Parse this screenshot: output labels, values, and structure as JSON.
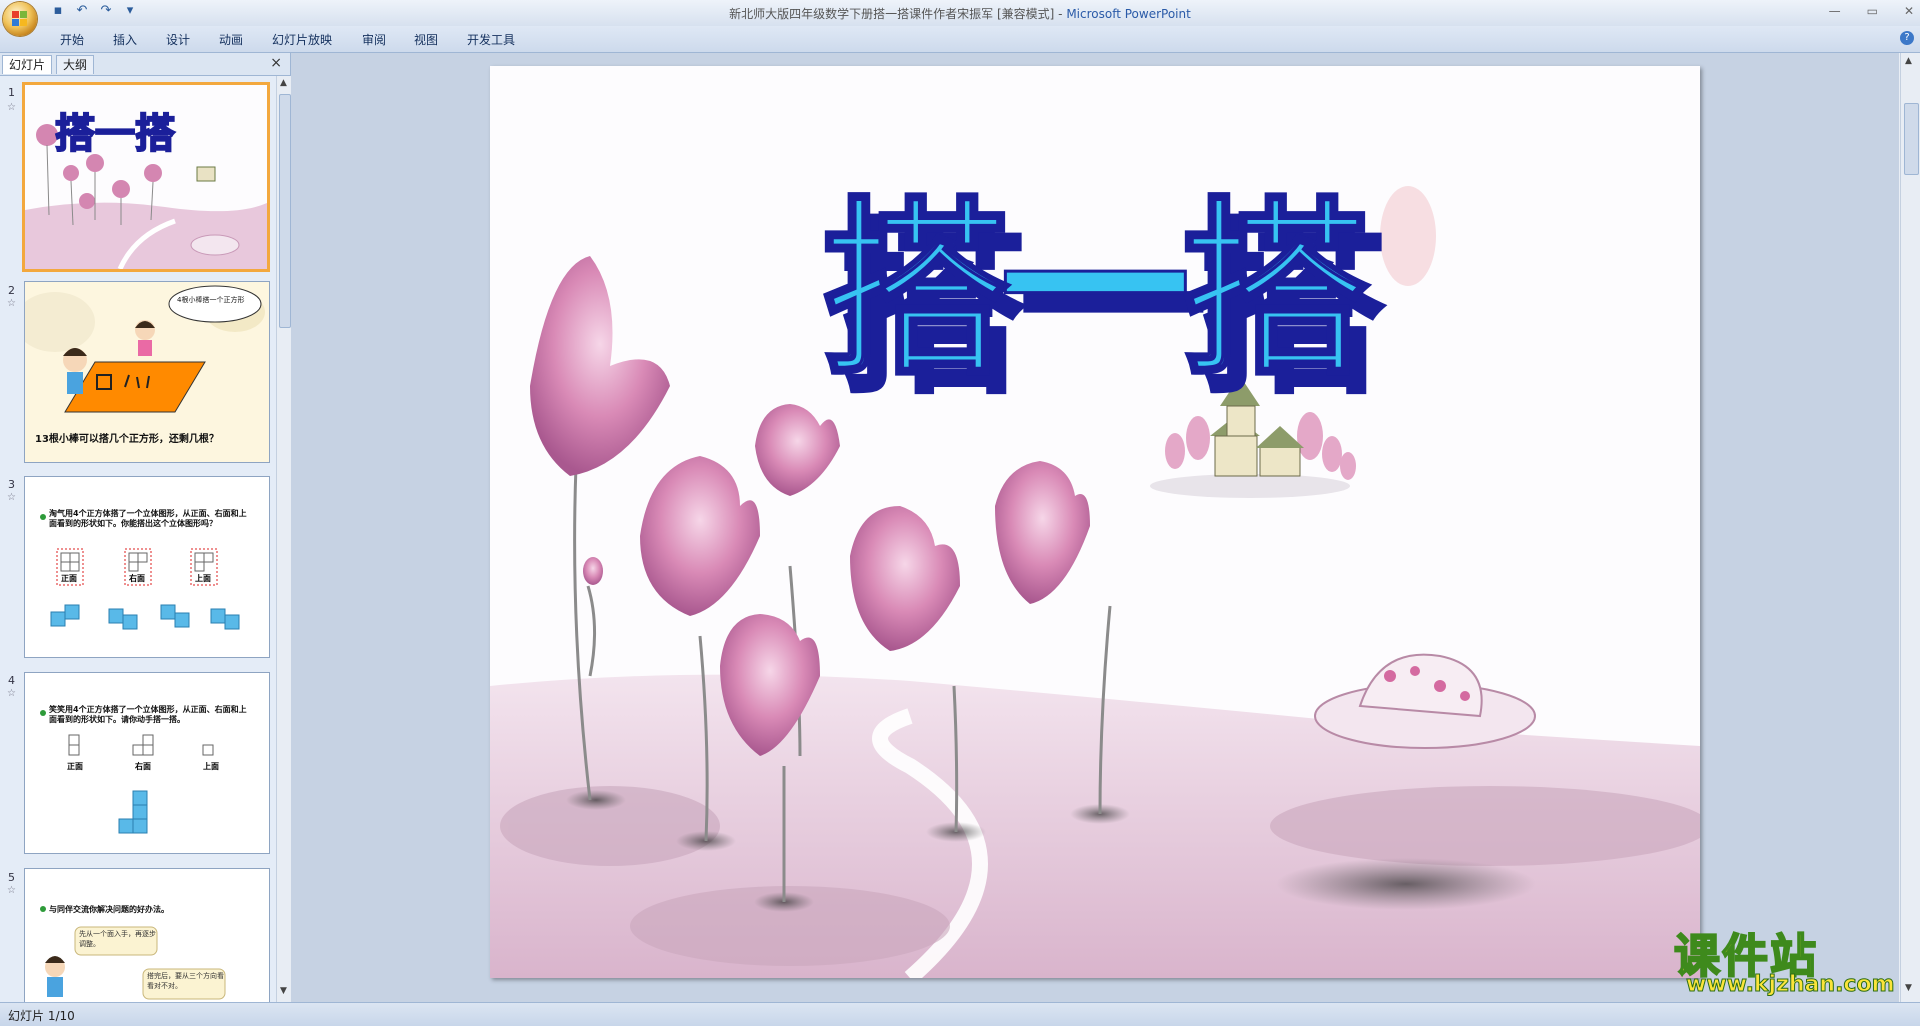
{
  "window": {
    "title": "新北师大版四年级数学下册搭一搭课件作者宋振军 [兼容模式]",
    "app_name": "Microsoft PowerPoint",
    "separator": " - "
  },
  "ribbon": {
    "tabs": [
      "开始",
      "插入",
      "设计",
      "动画",
      "幻灯片放映",
      "审阅",
      "视图",
      "开发工具"
    ]
  },
  "left_pane": {
    "tab_slides": "幻灯片",
    "tab_outline": "大纲",
    "close": "×"
  },
  "thumbnails": [
    {
      "number": "1",
      "title": "搭一搭",
      "selected": true
    },
    {
      "number": "2",
      "bubble": "4根小棒搭一个正方形",
      "caption": "13根小棒可以搭几个正方形，还剩几根？"
    },
    {
      "number": "3",
      "text": "淘气用4个正方体搭了一个立体图形，从正面、右面和上面看到的形状如下。你能搭出这个立体图形吗？",
      "views": [
        "正面",
        "右面",
        "上面"
      ]
    },
    {
      "number": "4",
      "text": "笑笑用4个正方体搭了一个立体图形，从正面、右面和上面看到的形状如下。请你动手搭一搭。",
      "views": [
        "正面",
        "右面",
        "上面"
      ]
    },
    {
      "number": "5",
      "text": "与同伴交流你解决问题的好办法。",
      "bubble1": "先从一个面入手，再逐步调整。",
      "bubble2": "搭完后，要从三个方向看看对不对。"
    }
  ],
  "slide": {
    "title": "搭一搭"
  },
  "status": {
    "text": "幻灯片 1/10"
  },
  "watermark": {
    "line1": "课件站",
    "line2": "www.kjzhan.com"
  },
  "colors": {
    "title_fill": "#37c3f2",
    "title_shadow": "#1b1f9a",
    "flower_pink": "#d98ab6",
    "ground_pink": "#e9c9de",
    "selection_orange": "#f3a83e"
  }
}
